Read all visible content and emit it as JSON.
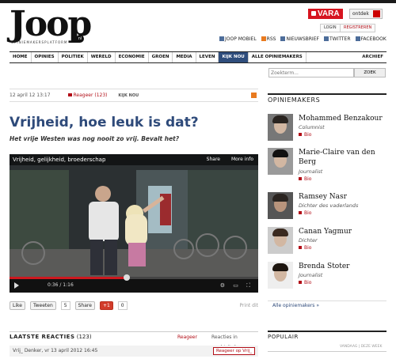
{
  "header": {
    "logo": "Joop",
    "logo_badge": "nl",
    "tagline": "OPINIEMAKERSPLATFORM",
    "vara": "VARA",
    "ontdek": "ontdek",
    "login": "LOGIN",
    "register": "REGISTREREN",
    "social": [
      "JOOP MOBIEL",
      "RSS",
      "NIEUWSBRIEF",
      "TWITTER",
      "FACEBOOK"
    ]
  },
  "nav": {
    "items": [
      "HOME",
      "OPINIES",
      "POLITIEK",
      "WERELD",
      "ECONOMIE",
      "GROEN",
      "MEDIA",
      "LEVEN",
      "KIJK NOU",
      "ALLE OPINIEMAKERS"
    ],
    "active": "KIJK NOU",
    "archive": "ARCHIEF"
  },
  "search": {
    "placeholder": "Zoekterm...",
    "button": "ZOEK"
  },
  "article": {
    "date": "12 april 12 13:17",
    "reactions": "Reageer",
    "reaction_count": "(123)",
    "category": "KIJK NOU",
    "title": "Vrijheid, hoe leuk is dat?",
    "lede": "Het vrije Westen was nog nooit zo vrij. Bevalt het?"
  },
  "video": {
    "title": "Vrijheid, gelijkheid, broederschap",
    "share": "Share",
    "more_info": "More info",
    "time": "0:36 / 1:16",
    "progress": 0.47
  },
  "share": {
    "like": "Like",
    "tweet": "Tweeten",
    "tweet_count": "5",
    "linkedin": "Share",
    "gplus": "+1",
    "gplus_count": "0",
    "print": "Print dit"
  },
  "comments": {
    "heading": "LAATSTE REACTIES",
    "count": "(123)",
    "reageer": "Reageer",
    "queue": "Reacties in wachtrij: 0",
    "first_author": "Vrij_ Denker, vr 13 april 2012 16:45",
    "reply": "Reageer op Vrij_"
  },
  "sidebar": {
    "heading": "OPINIEMAKERS",
    "makers": [
      {
        "name": "Mohammed Benzakour",
        "role": "Columnist",
        "bio": "Bio"
      },
      {
        "name": "Marie-Claire van den Berg",
        "role": "Journalist",
        "bio": "Bio"
      },
      {
        "name": "Ramsey Nasr",
        "role": "Dichter des vaderlands",
        "bio": "Bio"
      },
      {
        "name": "Canan Yagmur",
        "role": "Dichter",
        "bio": "Bio"
      },
      {
        "name": "Brenda Stoter",
        "role": "Journalist",
        "bio": "Bio"
      }
    ],
    "all_link": "Alle opiniemakers »",
    "popular": "POPULAIR",
    "popular_sub": "VANDAAG | DEZE WEEK"
  }
}
